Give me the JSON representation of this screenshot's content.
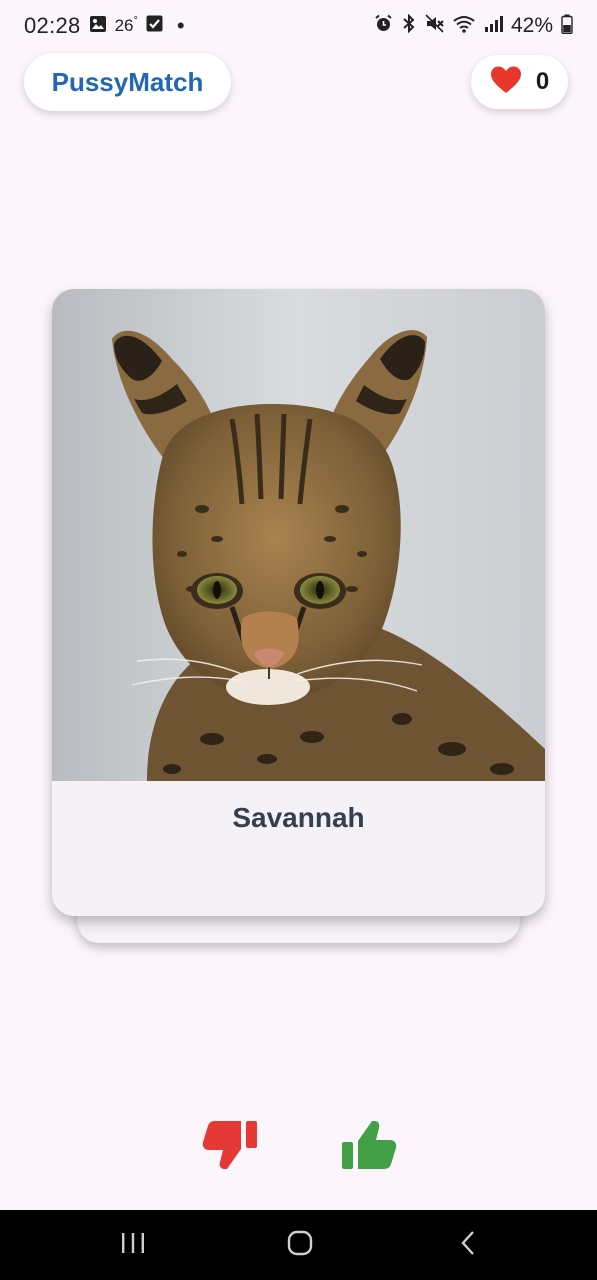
{
  "status_bar": {
    "time": "02:28",
    "temperature": "26",
    "temperature_unit": "°",
    "battery_percent": "42%",
    "icons": [
      "gallery-icon",
      "check-square-icon",
      "dot-icon",
      "alarm-icon",
      "bluetooth-icon",
      "mute-icon",
      "wifi-icon",
      "signal-icon",
      "battery-icon"
    ]
  },
  "header": {
    "app_title": "PussyMatch",
    "likes_icon": "heart-icon",
    "likes_count": "0"
  },
  "card": {
    "breed_name": "Savannah",
    "photo_subject": "cat-photo"
  },
  "actions": {
    "dislike_icon": "thumbs-down-icon",
    "like_icon": "thumbs-up-icon"
  },
  "navigation": {
    "recents_icon": "recents-icon",
    "home_icon": "home-icon",
    "back_icon": "back-icon"
  },
  "colors": {
    "background": "#fcf5fb",
    "brand": "#2167b3",
    "heart": "#e8362d",
    "dislike": "#e53935",
    "like": "#43a047",
    "card_name": "#353f4e",
    "nav_bar": "#000000"
  }
}
